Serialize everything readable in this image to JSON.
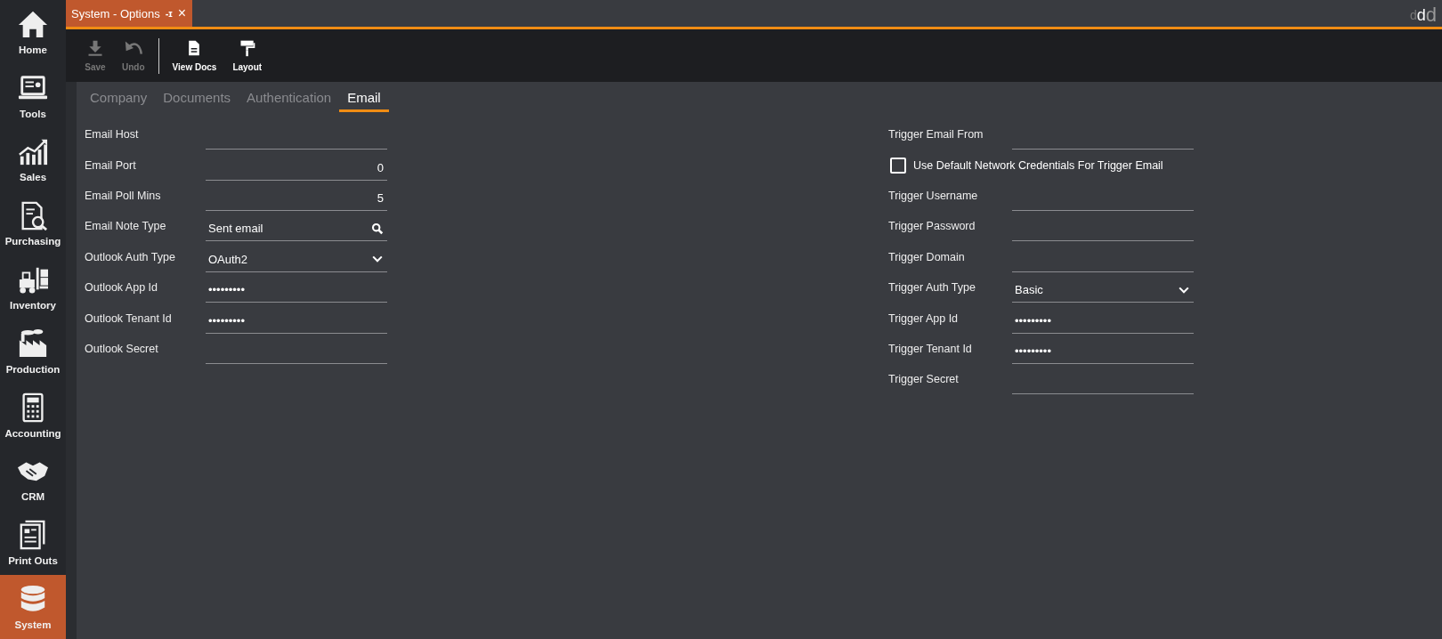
{
  "sidebar": {
    "items": [
      {
        "label": "Home",
        "selected": false
      },
      {
        "label": "Tools",
        "selected": false
      },
      {
        "label": "Sales",
        "selected": false
      },
      {
        "label": "Purchasing",
        "selected": false
      },
      {
        "label": "Inventory",
        "selected": false
      },
      {
        "label": "Production",
        "selected": false
      },
      {
        "label": "Accounting",
        "selected": false
      },
      {
        "label": "CRM",
        "selected": false
      },
      {
        "label": "Print Outs",
        "selected": false
      },
      {
        "label": "System",
        "selected": true
      }
    ]
  },
  "document_tab": {
    "title": "System - Options",
    "pin": "-ɪ",
    "close": "×"
  },
  "logo": [
    "d",
    "d",
    "d"
  ],
  "toolbar": {
    "buttons": [
      {
        "label": "Save",
        "disabled": true
      },
      {
        "label": "Undo",
        "disabled": true
      },
      {
        "label": "View Docs",
        "disabled": false
      },
      {
        "label": "Layout",
        "disabled": false
      }
    ]
  },
  "tabs": [
    {
      "label": "Company",
      "selected": false
    },
    {
      "label": "Documents",
      "selected": false
    },
    {
      "label": "Authentication",
      "selected": false
    },
    {
      "label": "Email",
      "selected": true
    }
  ],
  "left_fields": [
    {
      "kind": "text",
      "label": "Email Host"
    },
    {
      "kind": "number",
      "label": "Email Port",
      "value": "0"
    },
    {
      "kind": "number",
      "label": "Email Poll Mins",
      "value": "5"
    },
    {
      "kind": "lookup",
      "label": "Email Note Type",
      "value": "Sent email"
    },
    {
      "kind": "select",
      "label": "Outlook Auth Type",
      "value": "OAuth2"
    },
    {
      "kind": "text",
      "label": "Outlook App Id",
      "value": "•••••••••"
    },
    {
      "kind": "text",
      "label": "Outlook Tenant Id",
      "value": "•••••••••"
    },
    {
      "kind": "text",
      "label": "Outlook Secret"
    }
  ],
  "right_fields": [
    {
      "kind": "text",
      "label": "Trigger Email From"
    },
    {
      "kind": "checkbox",
      "label": "Use Default Network Credentials For Trigger Email",
      "checked": false
    },
    {
      "kind": "text",
      "label": "Trigger Username"
    },
    {
      "kind": "text",
      "label": "Trigger Password"
    },
    {
      "kind": "text",
      "label": "Trigger Domain"
    },
    {
      "kind": "select",
      "label": "Trigger Auth Type",
      "value": "Basic"
    },
    {
      "kind": "text",
      "label": "Trigger App Id",
      "value": "•••••••••"
    },
    {
      "kind": "text",
      "label": "Trigger Tenant Id",
      "value": "•••••••••"
    },
    {
      "kind": "text",
      "label": "Trigger Secret"
    }
  ]
}
